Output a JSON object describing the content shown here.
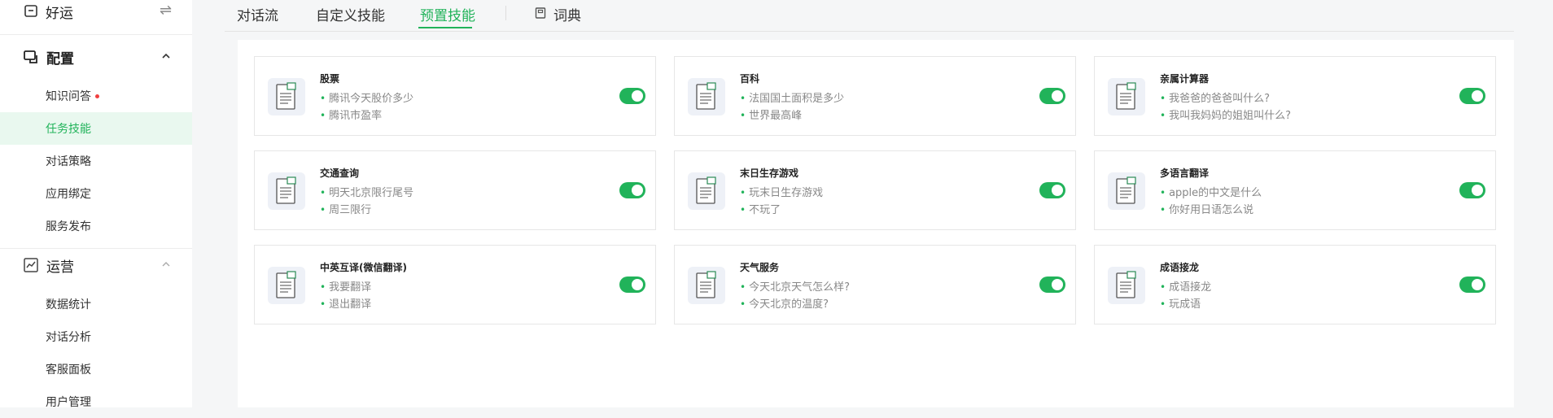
{
  "sidebar": {
    "top_label": "好运",
    "groups": [
      {
        "label": "配置",
        "items": [
          {
            "label": "知识问答",
            "badge_dot": true
          },
          {
            "label": "任务技能",
            "active": true
          },
          {
            "label": "对话策略"
          },
          {
            "label": "应用绑定"
          },
          {
            "label": "服务发布"
          }
        ]
      },
      {
        "label": "运营",
        "items": [
          {
            "label": "数据统计"
          },
          {
            "label": "对话分析"
          },
          {
            "label": "客服面板"
          },
          {
            "label": "用户管理"
          }
        ]
      }
    ]
  },
  "tabs": [
    {
      "label": "对话流"
    },
    {
      "label": "自定义技能"
    },
    {
      "label": "预置技能",
      "active": true
    },
    {
      "label": "词典"
    }
  ],
  "skills": [
    {
      "title": "股票",
      "examples": [
        "腾讯今天股价多少",
        "腾讯市盈率"
      ],
      "enabled": true
    },
    {
      "title": "百科",
      "examples": [
        "法国国土面积是多少",
        "世界最高峰"
      ],
      "enabled": true
    },
    {
      "title": "亲属计算器",
      "examples": [
        "我爸爸的爸爸叫什么?",
        "我叫我妈妈的姐姐叫什么?"
      ],
      "enabled": true
    },
    {
      "title": "交通查询",
      "examples": [
        "明天北京限行尾号",
        "周三限行"
      ],
      "enabled": true
    },
    {
      "title": "末日生存游戏",
      "examples": [
        "玩末日生存游戏",
        "不玩了"
      ],
      "enabled": true
    },
    {
      "title": "多语言翻译",
      "examples": [
        "apple的中文是什么",
        "你好用日语怎么说"
      ],
      "enabled": true
    },
    {
      "title": "中英互译(微信翻译)",
      "examples": [
        "我要翻译",
        "退出翻译"
      ],
      "enabled": true
    },
    {
      "title": "天气服务",
      "examples": [
        "今天北京天气怎么样?",
        "今天北京的温度?"
      ],
      "enabled": true
    },
    {
      "title": "成语接龙",
      "examples": [
        "成语接龙",
        "玩成语"
      ],
      "enabled": true
    }
  ],
  "colors": {
    "accent": "#21b35a",
    "badge": "#f04040"
  }
}
